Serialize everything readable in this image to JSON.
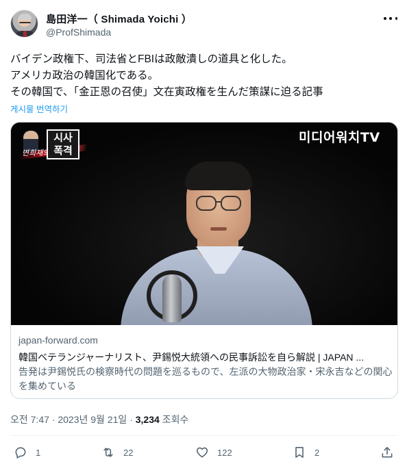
{
  "author": {
    "display_name": "島田洋一（ Shimada Yoichi ）",
    "handle": "@ProfShimada"
  },
  "tweet": {
    "lines": [
      "バイデン政権下、司法省とFBIは政敵潰しの道具と化した。",
      "アメリカ政治の韓国化である。",
      "その韓国で、「金正恩の召使」文在寅政権を生んだ策謀に迫る記事"
    ],
    "translate_label": "게시물 번역하기"
  },
  "card": {
    "image": {
      "program_badge_line1": "시사",
      "program_badge_line2": "폭격",
      "signature_text": "변희재의",
      "channel_logo_text": "미디어워치TV"
    },
    "domain": "japan-forward.com",
    "title": "韓国ベテランジャーナリスト、尹錫悦大統領への民事訴訟を自ら解説 | JAPAN ...",
    "description": "告発は尹錫悦氏の検察時代の問題を巡るもので、左派の大物政治家・宋永吉などの関心を集めている"
  },
  "meta": {
    "time": "오전 7:47",
    "separator": "·",
    "date": "2023년 9월 21일",
    "views_count": "3,234",
    "views_label": "조회수"
  },
  "actions": {
    "reply_count": "1",
    "retweet_count": "22",
    "like_count": "122",
    "bookmark_count": "2"
  },
  "icons": {
    "more": "more-dots-icon",
    "reply": "speech-bubble-icon",
    "retweet": "repost-arrows-icon",
    "like": "heart-icon",
    "bookmark": "bookmark-icon",
    "share": "upload-share-icon"
  },
  "colors": {
    "link": "#1d9bf0",
    "secondary_text": "#536471",
    "primary_text": "#0f1419",
    "border": "#cfd9de"
  }
}
